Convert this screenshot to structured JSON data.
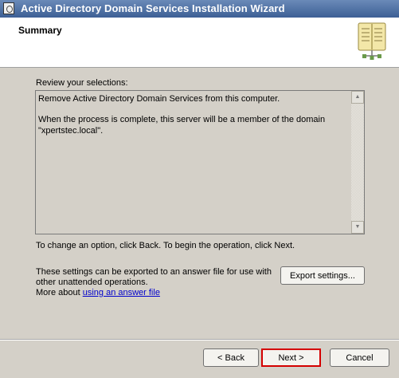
{
  "window": {
    "title": "Active Directory Domain Services Installation Wizard"
  },
  "header": {
    "title": "Summary",
    "icon": "book-icon"
  },
  "main": {
    "review_label": "Review your selections:",
    "summary_lines": [
      "Remove Active Directory Domain Services from this computer.",
      "When the process is complete, this server will be a member of the domain \"xpertstec.local\"."
    ],
    "change_instructions": "To change an option, click Back. To begin the operation, click Next.",
    "export_note_line1": "These settings can be exported to an answer file for use with",
    "export_note_line2": "other unattended operations.",
    "more_about_prefix": "More about",
    "answer_file_link": "using an answer file",
    "export_button": "Export settings...",
    "scroll_up": "▲",
    "scroll_down": "▼"
  },
  "footer": {
    "back_button": "< Back",
    "next_button": "Next >",
    "cancel_button": "Cancel"
  },
  "colors": {
    "highlight": "#d40000",
    "link": "#0000cc"
  }
}
